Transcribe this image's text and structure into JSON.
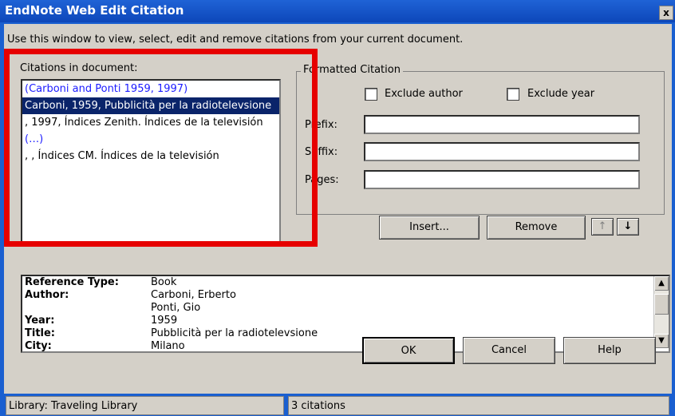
{
  "window": {
    "title": "EndNote Web Edit Citation",
    "close_glyph": "x"
  },
  "instructions": "Use this window to view, select, edit and remove citations from your current document.",
  "citations": {
    "label": "Citations in document:",
    "items": [
      {
        "text": "(Carboni and Ponti 1959, 1997)",
        "kind": "group"
      },
      {
        "text": " Carboni, 1959, Pubblicità per la radiotelevsione",
        "kind": "selected"
      },
      {
        "text": " , 1997, Índices Zenith. Índices de la televisión",
        "kind": "normal"
      },
      {
        "text": "(…)",
        "kind": "group"
      },
      {
        "text": " , , Índices CM. Índices de la televisión",
        "kind": "normal"
      }
    ]
  },
  "formatted": {
    "legend": "Formatted Citation",
    "exclude_author": "Exclude author",
    "exclude_year": "Exclude year",
    "prefix_label": "Prefix:",
    "suffix_label": "Suffix:",
    "pages_label": "Pages:",
    "prefix_value": "",
    "suffix_value": "",
    "pages_value": ""
  },
  "buttons": {
    "insert": "Insert...",
    "remove": "Remove",
    "move_up": "↑",
    "move_down": "↓",
    "ok": "OK",
    "cancel": "Cancel",
    "help": "Help"
  },
  "reference": {
    "rows": [
      {
        "key": "Reference Type:",
        "value": "Book"
      },
      {
        "key": "Author:",
        "value": "Carboni, Erberto"
      },
      {
        "key": "",
        "value": "Ponti, Gio"
      },
      {
        "key": "Year:",
        "value": "1959"
      },
      {
        "key": "Title:",
        "value": "Pubblicità per la radiotelevsione"
      },
      {
        "key": "City:",
        "value": "Milano"
      }
    ]
  },
  "status": {
    "library": "Library: Traveling Library",
    "count": "3 citations"
  },
  "colors": {
    "title_bar": "#0d47b9",
    "highlight": "#e60000",
    "group_text": "#1b1bff"
  }
}
